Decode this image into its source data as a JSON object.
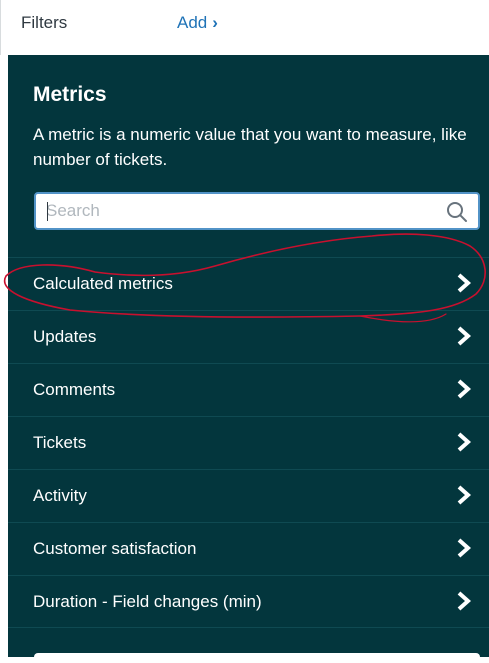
{
  "filters": {
    "label": "Filters",
    "add_label": "Add",
    "add_chevron": "›"
  },
  "metrics_panel": {
    "title": "Metrics",
    "description": "A metric is a numeric value that you want to measure, like number of tickets.",
    "search": {
      "placeholder": "Search",
      "value": "",
      "icon": "search-icon"
    },
    "items": [
      {
        "label": "Calculated metrics",
        "icon": "chevron-right-icon"
      },
      {
        "label": "Updates",
        "icon": "chevron-right-icon"
      },
      {
        "label": "Comments",
        "icon": "chevron-right-icon"
      },
      {
        "label": "Tickets",
        "icon": "chevron-right-icon"
      },
      {
        "label": "Activity",
        "icon": "chevron-right-icon"
      },
      {
        "label": "Customer satisfaction",
        "icon": "chevron-right-icon"
      },
      {
        "label": "Duration - Field changes (min)",
        "icon": "chevron-right-icon"
      }
    ]
  },
  "colors": {
    "panel_bg": "#03363d",
    "link": "#1f73b7",
    "search_border": "#5293c7",
    "annotation_stroke": "#c8102e"
  }
}
